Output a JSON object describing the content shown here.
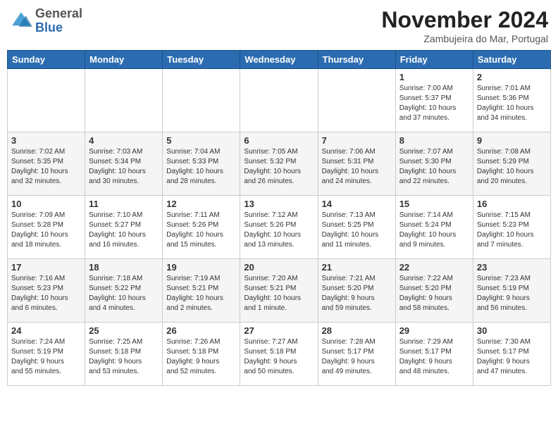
{
  "logo": {
    "general": "General",
    "blue": "Blue"
  },
  "header": {
    "month_year": "November 2024",
    "location": "Zambujeira do Mar, Portugal"
  },
  "days_of_week": [
    "Sunday",
    "Monday",
    "Tuesday",
    "Wednesday",
    "Thursday",
    "Friday",
    "Saturday"
  ],
  "weeks": [
    [
      {
        "day": null,
        "info": ""
      },
      {
        "day": null,
        "info": ""
      },
      {
        "day": null,
        "info": ""
      },
      {
        "day": null,
        "info": ""
      },
      {
        "day": null,
        "info": ""
      },
      {
        "day": "1",
        "info": "Sunrise: 7:00 AM\nSunset: 5:37 PM\nDaylight: 10 hours\nand 37 minutes."
      },
      {
        "day": "2",
        "info": "Sunrise: 7:01 AM\nSunset: 5:36 PM\nDaylight: 10 hours\nand 34 minutes."
      }
    ],
    [
      {
        "day": "3",
        "info": "Sunrise: 7:02 AM\nSunset: 5:35 PM\nDaylight: 10 hours\nand 32 minutes."
      },
      {
        "day": "4",
        "info": "Sunrise: 7:03 AM\nSunset: 5:34 PM\nDaylight: 10 hours\nand 30 minutes."
      },
      {
        "day": "5",
        "info": "Sunrise: 7:04 AM\nSunset: 5:33 PM\nDaylight: 10 hours\nand 28 minutes."
      },
      {
        "day": "6",
        "info": "Sunrise: 7:05 AM\nSunset: 5:32 PM\nDaylight: 10 hours\nand 26 minutes."
      },
      {
        "day": "7",
        "info": "Sunrise: 7:06 AM\nSunset: 5:31 PM\nDaylight: 10 hours\nand 24 minutes."
      },
      {
        "day": "8",
        "info": "Sunrise: 7:07 AM\nSunset: 5:30 PM\nDaylight: 10 hours\nand 22 minutes."
      },
      {
        "day": "9",
        "info": "Sunrise: 7:08 AM\nSunset: 5:29 PM\nDaylight: 10 hours\nand 20 minutes."
      }
    ],
    [
      {
        "day": "10",
        "info": "Sunrise: 7:09 AM\nSunset: 5:28 PM\nDaylight: 10 hours\nand 18 minutes."
      },
      {
        "day": "11",
        "info": "Sunrise: 7:10 AM\nSunset: 5:27 PM\nDaylight: 10 hours\nand 16 minutes."
      },
      {
        "day": "12",
        "info": "Sunrise: 7:11 AM\nSunset: 5:26 PM\nDaylight: 10 hours\nand 15 minutes."
      },
      {
        "day": "13",
        "info": "Sunrise: 7:12 AM\nSunset: 5:26 PM\nDaylight: 10 hours\nand 13 minutes."
      },
      {
        "day": "14",
        "info": "Sunrise: 7:13 AM\nSunset: 5:25 PM\nDaylight: 10 hours\nand 11 minutes."
      },
      {
        "day": "15",
        "info": "Sunrise: 7:14 AM\nSunset: 5:24 PM\nDaylight: 10 hours\nand 9 minutes."
      },
      {
        "day": "16",
        "info": "Sunrise: 7:15 AM\nSunset: 5:23 PM\nDaylight: 10 hours\nand 7 minutes."
      }
    ],
    [
      {
        "day": "17",
        "info": "Sunrise: 7:16 AM\nSunset: 5:23 PM\nDaylight: 10 hours\nand 6 minutes."
      },
      {
        "day": "18",
        "info": "Sunrise: 7:18 AM\nSunset: 5:22 PM\nDaylight: 10 hours\nand 4 minutes."
      },
      {
        "day": "19",
        "info": "Sunrise: 7:19 AM\nSunset: 5:21 PM\nDaylight: 10 hours\nand 2 minutes."
      },
      {
        "day": "20",
        "info": "Sunrise: 7:20 AM\nSunset: 5:21 PM\nDaylight: 10 hours\nand 1 minute."
      },
      {
        "day": "21",
        "info": "Sunrise: 7:21 AM\nSunset: 5:20 PM\nDaylight: 9 hours\nand 59 minutes."
      },
      {
        "day": "22",
        "info": "Sunrise: 7:22 AM\nSunset: 5:20 PM\nDaylight: 9 hours\nand 58 minutes."
      },
      {
        "day": "23",
        "info": "Sunrise: 7:23 AM\nSunset: 5:19 PM\nDaylight: 9 hours\nand 56 minutes."
      }
    ],
    [
      {
        "day": "24",
        "info": "Sunrise: 7:24 AM\nSunset: 5:19 PM\nDaylight: 9 hours\nand 55 minutes."
      },
      {
        "day": "25",
        "info": "Sunrise: 7:25 AM\nSunset: 5:18 PM\nDaylight: 9 hours\nand 53 minutes."
      },
      {
        "day": "26",
        "info": "Sunrise: 7:26 AM\nSunset: 5:18 PM\nDaylight: 9 hours\nand 52 minutes."
      },
      {
        "day": "27",
        "info": "Sunrise: 7:27 AM\nSunset: 5:18 PM\nDaylight: 9 hours\nand 50 minutes."
      },
      {
        "day": "28",
        "info": "Sunrise: 7:28 AM\nSunset: 5:17 PM\nDaylight: 9 hours\nand 49 minutes."
      },
      {
        "day": "29",
        "info": "Sunrise: 7:29 AM\nSunset: 5:17 PM\nDaylight: 9 hours\nand 48 minutes."
      },
      {
        "day": "30",
        "info": "Sunrise: 7:30 AM\nSunset: 5:17 PM\nDaylight: 9 hours\nand 47 minutes."
      }
    ]
  ]
}
